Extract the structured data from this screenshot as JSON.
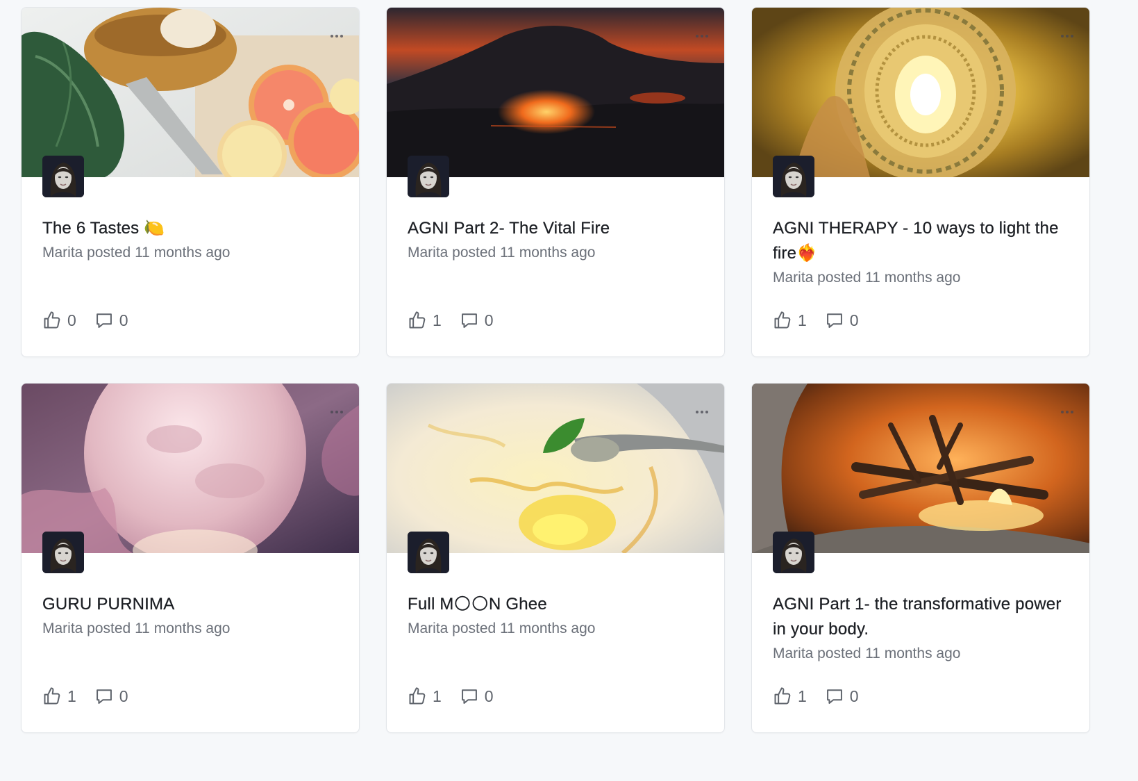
{
  "posts": [
    {
      "title": "The 6 Tastes 🍋",
      "meta": "Marita posted 11 months ago",
      "likes": "0",
      "comments": "0"
    },
    {
      "title": "AGNI Part 2- The Vital Fire",
      "meta": "Marita posted 11 months ago",
      "likes": "1",
      "comments": "0"
    },
    {
      "title": "AGNI THERAPY - 10 ways to light the fire❤️‍🔥",
      "meta": "Marita posted 11 months ago",
      "likes": "1",
      "comments": "0"
    },
    {
      "title": "GURU PURNIMA",
      "meta": "Marita posted 11 months ago",
      "likes": "1",
      "comments": "0"
    },
    {
      "title": "Full M🌕🌕N Ghee",
      "meta": "Marita posted 11 months ago",
      "likes": "1",
      "comments": "0"
    },
    {
      "title": "AGNI Part 1- the transformative power in your body.",
      "meta": "Marita posted 11 months ago",
      "likes": "1",
      "comments": "0"
    }
  ]
}
